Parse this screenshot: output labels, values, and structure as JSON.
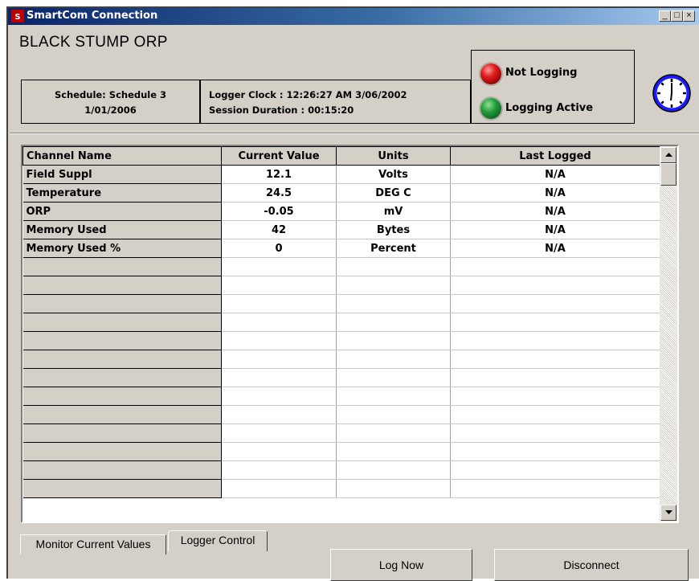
{
  "window": {
    "title": "SmartCom Connection",
    "controls": [
      "_",
      "□",
      "×"
    ]
  },
  "header": {
    "station_name": "BLACK STUMP ORP",
    "schedule_label": "Schedule: Schedule 3",
    "schedule_date": "1/01/2006",
    "logger_clock": "Logger Clock : 12:26:27 AM 3/06/2002",
    "session_duration": "Session Duration : 00:15:20",
    "status_not_logging": "Not Logging",
    "status_logging_active": "Logging Active",
    "colors": {
      "red_led": "#e21e1e",
      "green_led": "#1f9c3a",
      "clock": "#1a1aff"
    }
  },
  "grid": {
    "columns": [
      "Channel Name",
      "Current Value",
      "Units",
      "Last Logged"
    ],
    "rows": [
      [
        "Field Suppl",
        "12.1",
        "Volts",
        "N/A"
      ],
      [
        "Temperature",
        "24.5",
        "DEG C",
        "N/A"
      ],
      [
        "ORP",
        "-0.05",
        "mV",
        "N/A"
      ],
      [
        "Memory Used",
        "42",
        "Bytes",
        "N/A"
      ],
      [
        "Memory Used %",
        "0",
        "Percent",
        "N/A"
      ]
    ],
    "empty_rows": 13
  },
  "tabs": [
    "Monitor Current Values",
    "Logger Control"
  ],
  "buttons": {
    "log_now": "Log Now",
    "disconnect": "Disconnect"
  },
  "icons": {
    "app": "smartcom-app-icon",
    "clock": "clock-icon",
    "scroll_up": "arrow-up-icon",
    "scroll_down": "arrow-down-icon"
  }
}
